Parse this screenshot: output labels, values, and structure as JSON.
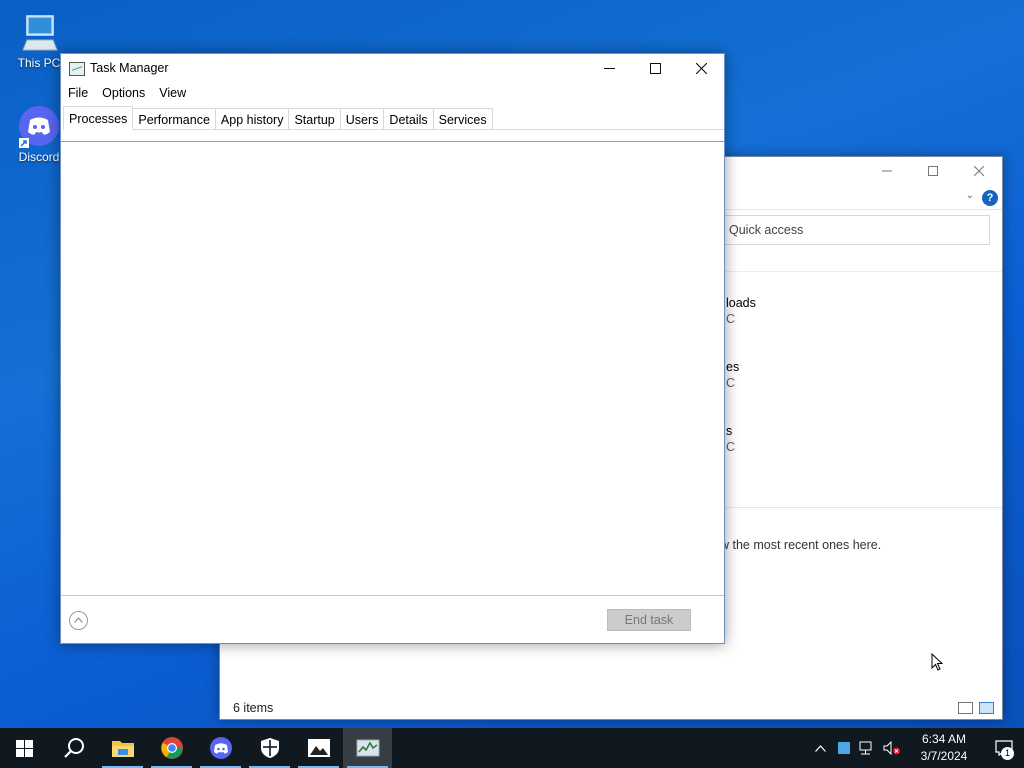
{
  "desktop": {
    "icons": [
      {
        "label": "This PC",
        "icon": "computer-icon"
      },
      {
        "label": "Discord",
        "icon": "discord-icon"
      }
    ]
  },
  "explorer": {
    "quick_access": "Quick access",
    "fragments": [
      {
        "text": "loads"
      },
      {
        "text": "C"
      },
      {
        "text": "es"
      },
      {
        "text": "C"
      },
      {
        "text": "s"
      },
      {
        "text": "C"
      }
    ],
    "recent_hint": "w the most recent ones here.",
    "status": "6 items",
    "help_label": "?"
  },
  "taskmgr": {
    "title": "Task Manager",
    "menu": [
      "File",
      "Options",
      "View"
    ],
    "tabs": [
      "Processes",
      "Performance",
      "App history",
      "Startup",
      "Users",
      "Details",
      "Services"
    ],
    "active_tab": "Processes",
    "end_task_label": "End task"
  },
  "taskbar": {
    "apps": [
      {
        "name": "start",
        "icon": "windows-icon"
      },
      {
        "name": "search",
        "icon": "search-icon"
      },
      {
        "name": "file-explorer",
        "icon": "folder-icon",
        "running": true
      },
      {
        "name": "chrome",
        "icon": "chrome-icon",
        "running": true
      },
      {
        "name": "discord",
        "icon": "discord-icon",
        "running": true
      },
      {
        "name": "security",
        "icon": "shield-icon",
        "running": true
      },
      {
        "name": "photos",
        "icon": "photos-icon",
        "running": true
      },
      {
        "name": "task-manager",
        "icon": "task-manager-icon",
        "running": true,
        "active": true
      }
    ],
    "time": "6:34 AM",
    "date": "3/7/2024",
    "notification_count": "1"
  },
  "colors": {
    "desktop": "#0b5ed4",
    "taskbar": "#101820",
    "accent": "#76b9ed"
  }
}
